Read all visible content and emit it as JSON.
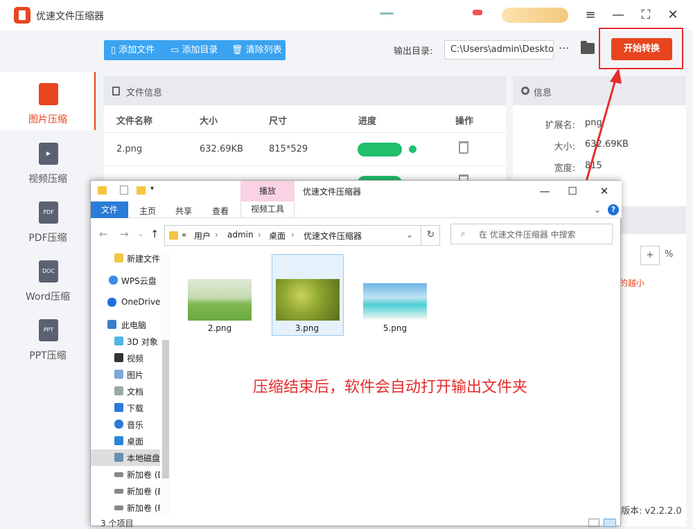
{
  "app": {
    "title": "优速文件压缩器",
    "window_buttons": [
      "≡",
      "—",
      "⛶",
      "✕"
    ]
  },
  "sidebar": {
    "items": [
      {
        "label": "图片压缩",
        "active": true,
        "icon": "image-file-icon"
      },
      {
        "label": "视频压缩",
        "active": false,
        "icon": "video-file-icon"
      },
      {
        "label": "PDF压缩",
        "active": false,
        "icon": "pdf-file-icon",
        "tag": "PDF"
      },
      {
        "label": "Word压缩",
        "active": false,
        "icon": "word-file-icon",
        "tag": "DOC"
      },
      {
        "label": "PPT压缩",
        "active": false,
        "icon": "ppt-file-icon",
        "tag": "PPT"
      }
    ]
  },
  "toolbar": {
    "add_file": "添加文件",
    "add_dir": "添加目录",
    "clear_list": "清除列表",
    "output_label": "输出目录:",
    "output_path": "C:\\Users\\admin\\Deskto",
    "more": "···",
    "start": "开始转换"
  },
  "file_panel": {
    "title": "文件信息",
    "columns": [
      "文件名称",
      "大小",
      "尺寸",
      "进度",
      "操作"
    ],
    "rows": [
      {
        "name": "2.png",
        "size": "632.69KB",
        "dims": "815*529",
        "progress": 1.0
      }
    ]
  },
  "info_panel": {
    "title": "信息",
    "fields": [
      {
        "label": "扩展名:",
        "value": "png"
      },
      {
        "label": "大小:",
        "value": "632.69KB"
      },
      {
        "label": "宽度:",
        "value": "815"
      }
    ],
    "plus": "+",
    "percent": "%",
    "hint": "的越小",
    "version": "版本: v2.2.2.0"
  },
  "explorer": {
    "title": "优速文件压缩器",
    "ribbon": {
      "play_tab": "播放",
      "file": "文件",
      "home": "主页",
      "share": "共享",
      "view": "查看",
      "video_tools": "视频工具"
    },
    "breadcrumb": [
      "«",
      "用户",
      "admin",
      "桌面",
      "优速文件压缩器"
    ],
    "search_placeholder": "在 优速文件压缩器 中搜索",
    "nav": [
      {
        "label": "新建文件夹",
        "icon": "folder-icon"
      },
      {
        "label": "WPS云盘",
        "icon": "cloud-icon"
      },
      {
        "label": "OneDrive",
        "icon": "onedrive-icon"
      },
      {
        "label": "此电脑",
        "icon": "computer-icon"
      },
      {
        "label": "3D 对象",
        "icon": "cube-icon"
      },
      {
        "label": "视频",
        "icon": "video-icon"
      },
      {
        "label": "图片",
        "icon": "picture-icon"
      },
      {
        "label": "文档",
        "icon": "document-icon"
      },
      {
        "label": "下载",
        "icon": "download-icon"
      },
      {
        "label": "音乐",
        "icon": "music-icon"
      },
      {
        "label": "桌面",
        "icon": "desktop-icon"
      },
      {
        "label": "本地磁盘 (C:)",
        "icon": "disk-icon",
        "selected": true
      },
      {
        "label": "新加卷 (D:)",
        "icon": "drive-icon"
      },
      {
        "label": "新加卷 (E:)",
        "icon": "drive-icon"
      },
      {
        "label": "新加卷 (F:)",
        "icon": "drive-icon"
      }
    ],
    "files": [
      {
        "name": "2.png"
      },
      {
        "name": "3.png",
        "selected": true
      },
      {
        "name": "5.png"
      }
    ],
    "status": "3 个项目"
  },
  "annotation": "压缩结束后，软件会自动打开输出文件夹",
  "colors": {
    "accent": "#e8451e",
    "blue": "#3ba3f0",
    "progress": "#1fbf6b",
    "annotation": "#e52d2d"
  }
}
